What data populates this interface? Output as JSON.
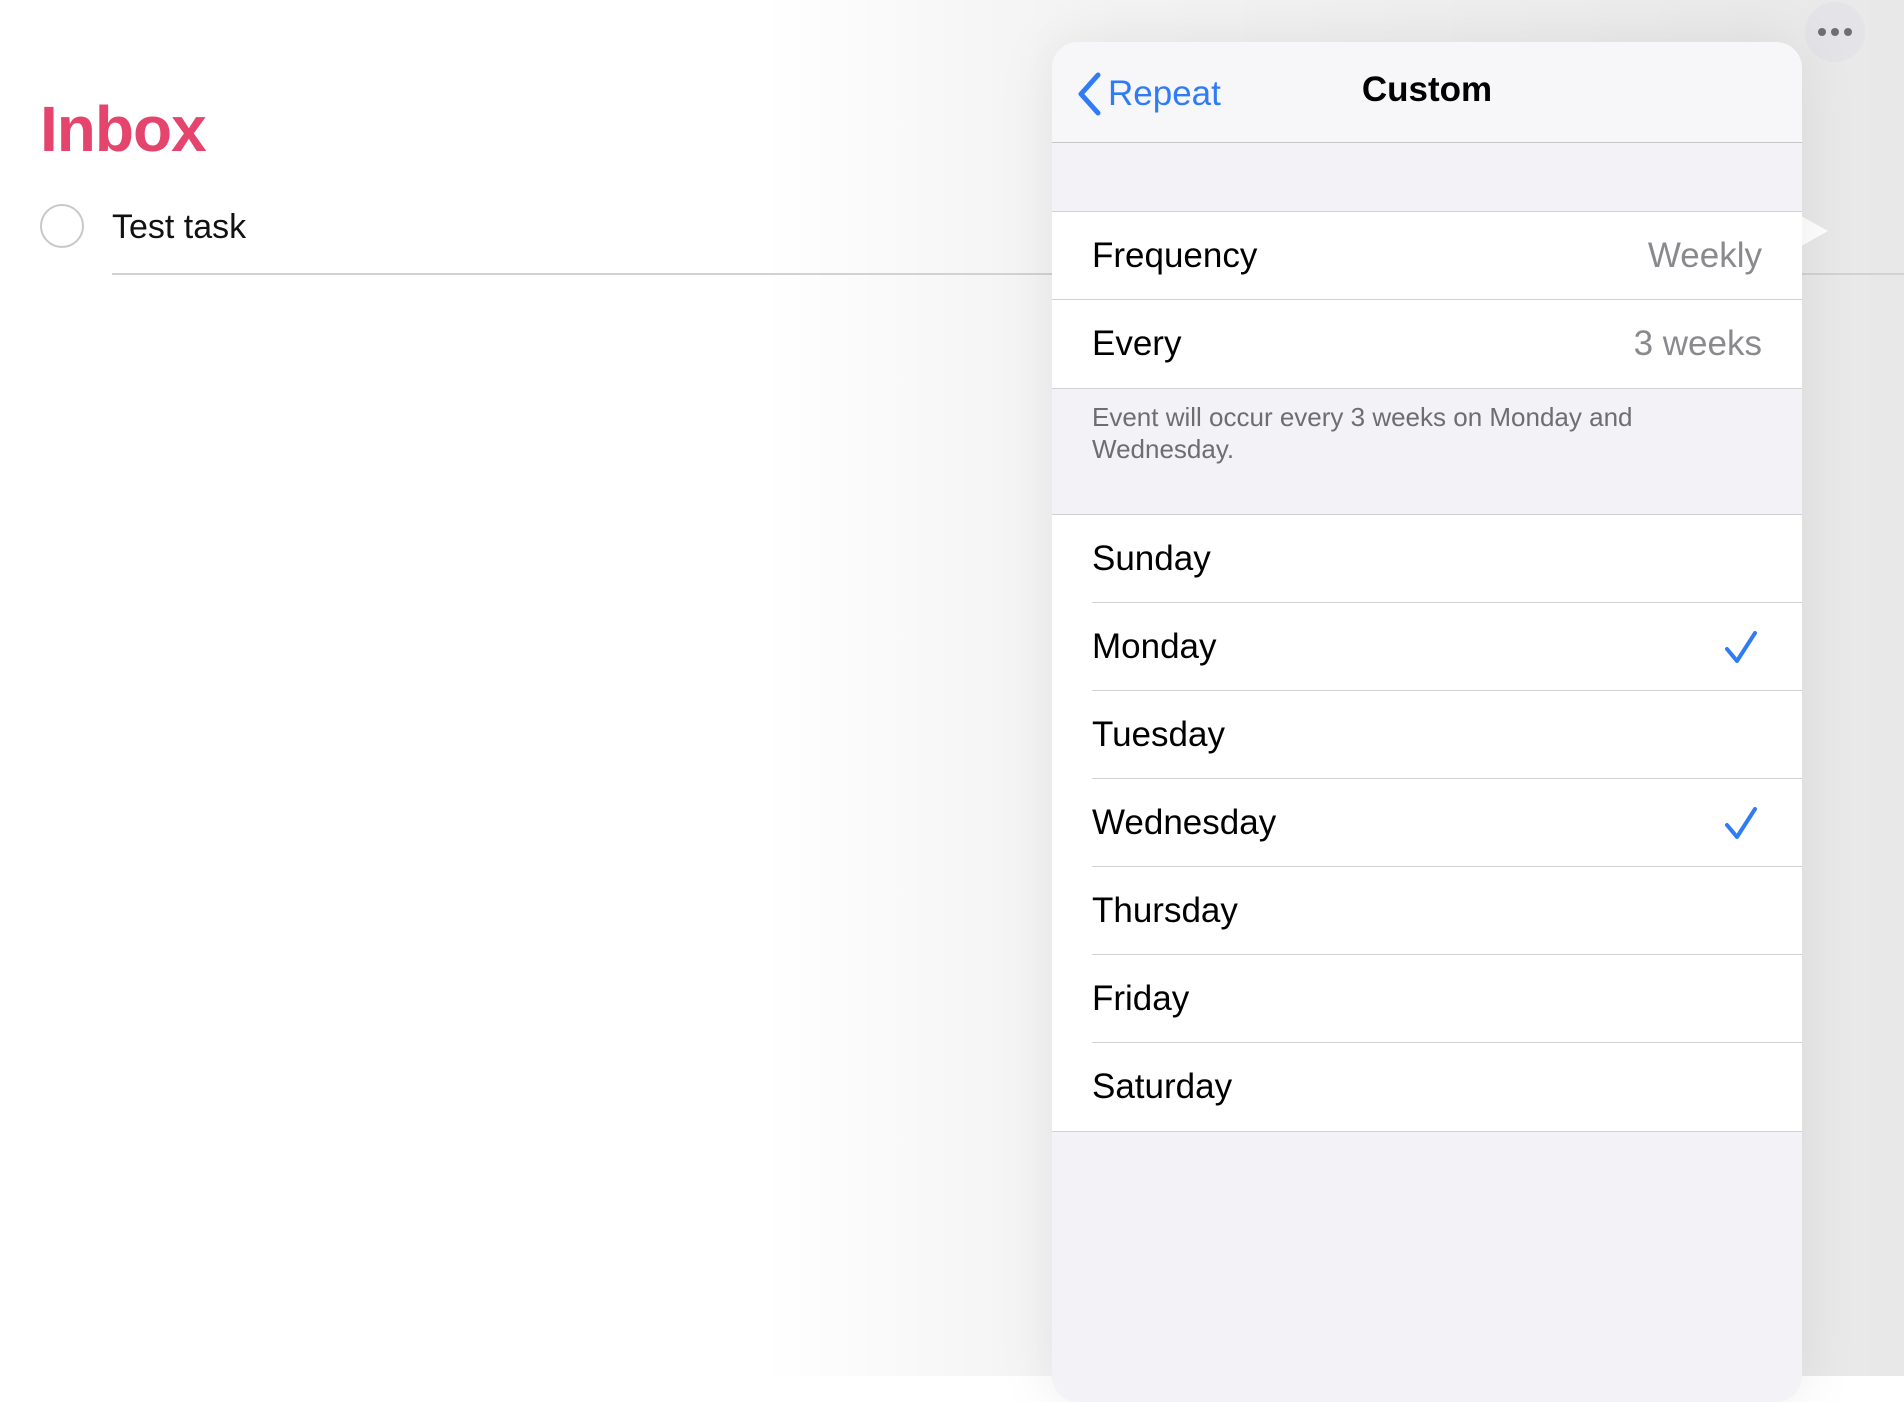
{
  "page": {
    "title": "Inbox",
    "title_color": "#e5446d",
    "tasks": [
      {
        "text": "Test task",
        "completed": false
      }
    ],
    "more_icon": "ellipsis-icon"
  },
  "popover": {
    "back_label": "Repeat",
    "title": "Custom",
    "accent_color": "#2f7cf6",
    "settings": [
      {
        "label": "Frequency",
        "value": "Weekly"
      },
      {
        "label": "Every",
        "value": "3 weeks"
      }
    ],
    "summary": "Event will occur every 3 weeks on Monday and Wednesday.",
    "days": [
      {
        "label": "Sunday",
        "checked": false
      },
      {
        "label": "Monday",
        "checked": true
      },
      {
        "label": "Tuesday",
        "checked": false
      },
      {
        "label": "Wednesday",
        "checked": true
      },
      {
        "label": "Thursday",
        "checked": false
      },
      {
        "label": "Friday",
        "checked": false
      },
      {
        "label": "Saturday",
        "checked": false
      }
    ]
  }
}
